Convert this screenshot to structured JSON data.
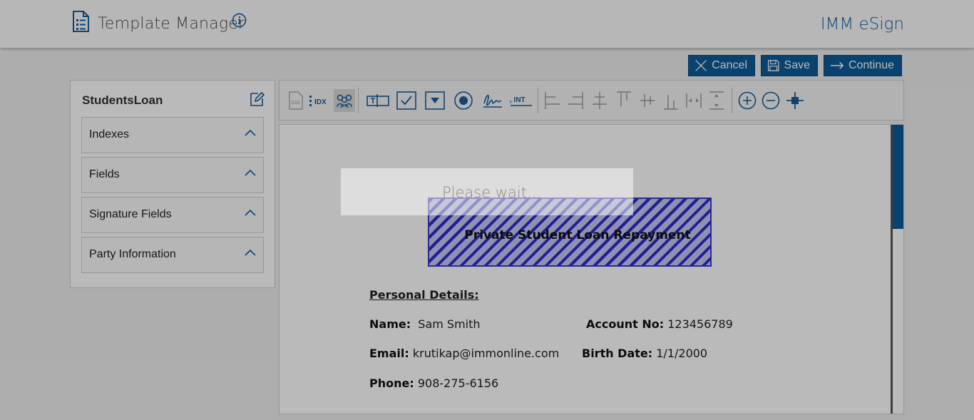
{
  "header": {
    "title": "Template Manager",
    "brand": "IMM eSign"
  },
  "actions": {
    "cancel_label": "Cancel",
    "save_label": "Save",
    "continue_label": "Continue"
  },
  "template": {
    "name": "StudentsLoan",
    "sections": [
      "Indexes",
      "Fields",
      "Signature Fields",
      "Party Information"
    ]
  },
  "toolbar": {
    "tools": [
      "doc-icon",
      "idx-icon",
      "party-icon",
      "text-field-icon",
      "checkbox-icon",
      "dropdown-icon",
      "radio-icon",
      "signature-icon",
      "initials-icon",
      "align-left-icon",
      "align-right-icon",
      "align-center-icon",
      "align-top-icon",
      "align-middle-icon",
      "align-bottom-icon",
      "distribute-horizontal-icon",
      "distribute-vertical-icon",
      "zoom-in-icon",
      "zoom-out-icon",
      "fit-icon"
    ],
    "idx_label": "IDX",
    "initials_label": ", INT"
  },
  "document": {
    "heading": "Private Student Loan Repayment",
    "section_title": "Personal Details:",
    "name_label": "Name:",
    "name_value": "Sam Smith",
    "account_label": "Account No:",
    "account_value": "123456789",
    "email_label": "Email:",
    "email_value": "krutikap@immonline.com",
    "birth_label": "Birth Date:",
    "birth_value": "1/1/2000",
    "phone_label": "Phone:",
    "phone_value": "908-275-6156"
  },
  "loader": {
    "text": "Please wait..."
  },
  "colors": {
    "accent": "#0d5a99",
    "brand": "#1a5c9a",
    "hatch": "#2d2dcc"
  }
}
